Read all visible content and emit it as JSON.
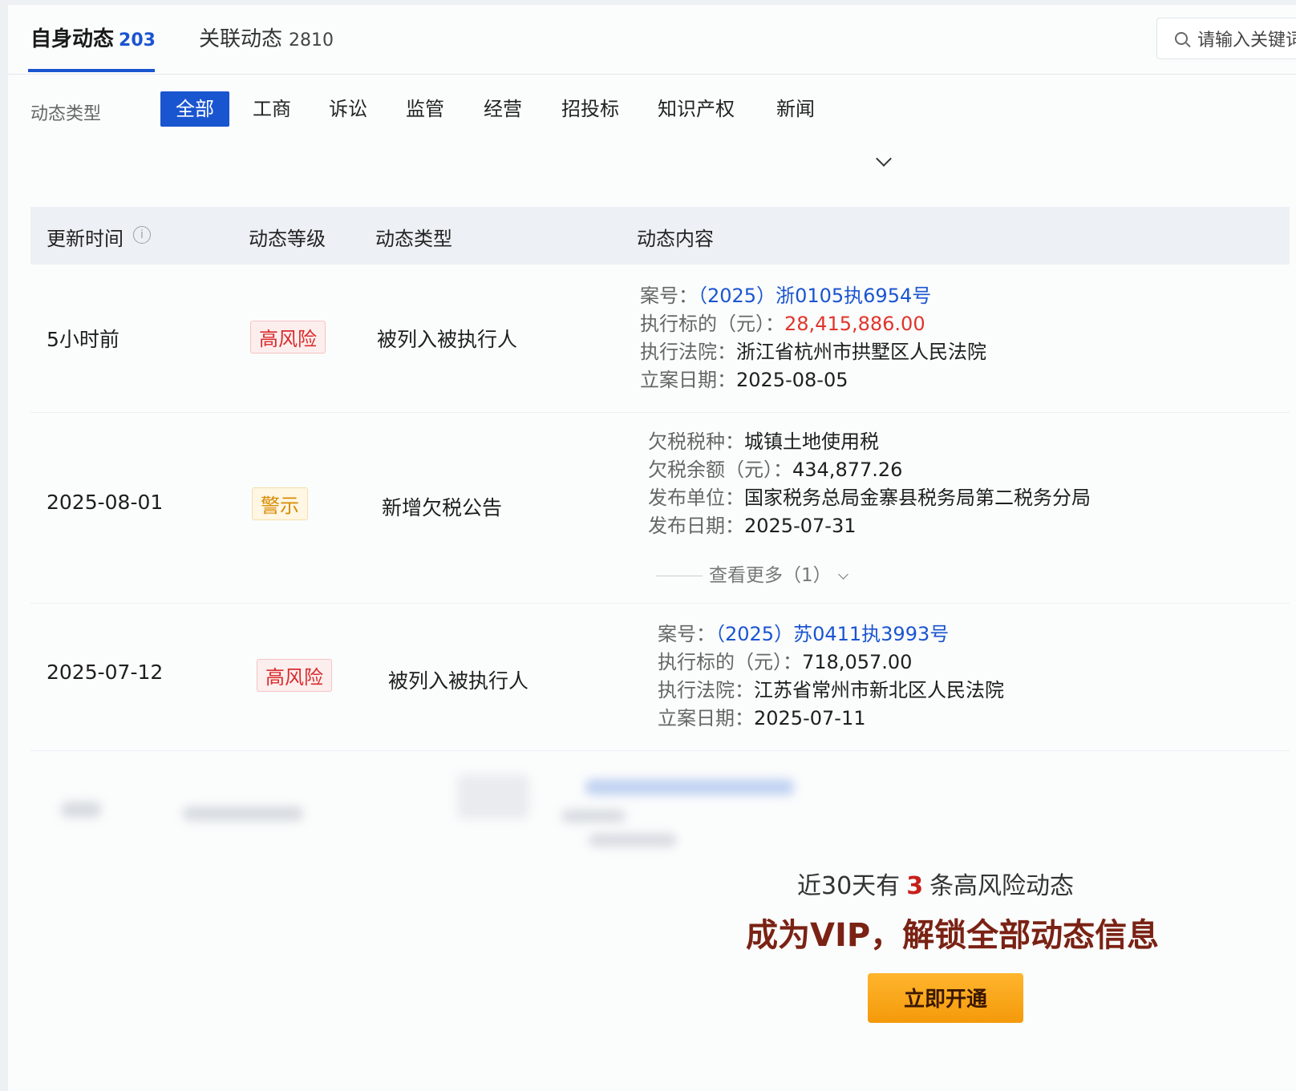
{
  "tabs": {
    "self": {
      "label": "自身动态",
      "count": "203"
    },
    "related": {
      "label": "关联动态",
      "count": "2810"
    }
  },
  "search": {
    "placeholder": "请输入关键词"
  },
  "filters": {
    "label": "动态类型",
    "items": [
      "全部",
      "工商",
      "诉讼",
      "监管",
      "经营",
      "招投标",
      "知识产权",
      "新闻"
    ],
    "active": "全部"
  },
  "table": {
    "headers": [
      "更新时间",
      "动态等级",
      "动态类型",
      "动态内容"
    ],
    "rows": [
      {
        "time": "5小时前",
        "level": "高风险",
        "type": "被列入被执行人",
        "details": [
          {
            "k": "案号：",
            "v": "（2025）浙0105执6954号"
          },
          {
            "k": "执行标的（元）：",
            "v": "28,415,886.00"
          },
          {
            "k": "执行法院：",
            "v": "浙江省杭州市拱墅区人民法院"
          },
          {
            "k": "立案日期：",
            "v": "2025-08-05"
          }
        ]
      },
      {
        "time": "2025-08-01",
        "level": "警示",
        "type": "新增欠税公告",
        "details": [
          {
            "k": "欠税税种：",
            "v": "城镇土地使用税"
          },
          {
            "k": "欠税余额（元）：",
            "v": "434,877.26"
          },
          {
            "k": "发布单位：",
            "v": "国家税务总局金寨县税务局第二税务分局"
          },
          {
            "k": "发布日期：",
            "v": "2025-07-31"
          }
        ],
        "more": "查看更多（1）"
      },
      {
        "time": "2025-07-12",
        "level": "高风险",
        "type": "被列入被执行人",
        "details": [
          {
            "k": "案号：",
            "v": "（2025）苏0411执3993号"
          },
          {
            "k": "执行标的（元）：",
            "v": "718,057.00"
          },
          {
            "k": "执行法院：",
            "v": "江苏省常州市新北区人民法院"
          },
          {
            "k": "立案日期：",
            "v": "2025-07-11"
          }
        ]
      }
    ]
  },
  "promo": {
    "line1_pre": "近30天有",
    "line1_num": "3",
    "line1_post": "条高风险动态",
    "line2": "成为VIP，解锁全部动态信息",
    "button": "立即开通"
  },
  "colors": {
    "accent": "#1a55d0",
    "risk_red": "#d92b2b",
    "warn_orange": "#d88a00",
    "vip_gold": "#f49a0a"
  }
}
